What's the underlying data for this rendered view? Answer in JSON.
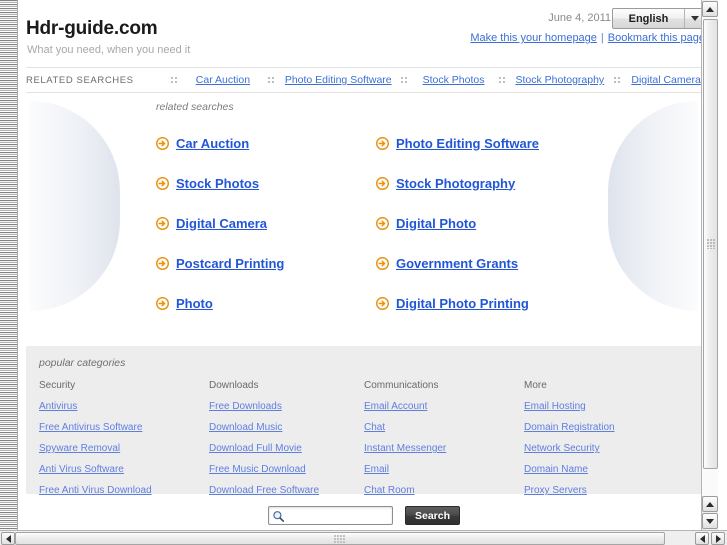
{
  "header": {
    "site_title": "Hdr-guide.com",
    "tagline": "What you need, when you need it",
    "date": "June 4, 2011",
    "language": "English",
    "caret_icon": "chevron-down-icon",
    "homepage_link": "Make this your homepage",
    "link_divider": "|",
    "bookmark_link": "Bookmark this page"
  },
  "nav": {
    "label": "RELATED SEARCHES",
    "items": [
      "Car Auction",
      "Photo Editing Software",
      "Stock Photos",
      "Stock Photography",
      "Digital Camera"
    ],
    "separator_icon": "dot-grid-separator-icon"
  },
  "related": {
    "caption": "related searches",
    "arrow_icon": "circle-arrow-right-icon",
    "items": [
      "Car Auction",
      "Photo Editing Software",
      "Stock Photos",
      "Stock Photography",
      "Digital Camera",
      "Digital Photo",
      "Postcard Printing",
      "Government Grants",
      "Photo",
      "Digital Photo Printing"
    ]
  },
  "categories": {
    "caption": "popular categories",
    "columns": [
      {
        "heading": "Security",
        "links": [
          "Antivirus",
          "Free Antivirus Software",
          "Spyware Removal",
          "Anti Virus Software",
          "Free Anti Virus Download"
        ]
      },
      {
        "heading": "Downloads",
        "links": [
          "Free Downloads",
          "Download Music",
          "Download Full Movie",
          "Free Music Download",
          "Download Free Software"
        ]
      },
      {
        "heading": "Communications",
        "links": [
          "Email Account",
          "Chat",
          "Instant Messenger",
          "Email",
          "Chat Room"
        ]
      },
      {
        "heading": "More",
        "links": [
          "Email Hosting",
          "Domain Registration",
          "Network Security",
          "Domain Name",
          "Proxy Servers"
        ]
      }
    ]
  },
  "search": {
    "value": "",
    "placeholder": "",
    "magnifier_icon": "search-icon",
    "button_label": "Search"
  },
  "scrollbars": {
    "up_icon": "triangle-up-icon",
    "down_icon": "triangle-down-icon",
    "left_icon": "triangle-left-icon",
    "right_icon": "triangle-right-icon"
  },
  "colors": {
    "link_blue": "#2255d8",
    "nav_link_blue": "#3b6fd6",
    "category_link_blue": "#5f7fe0",
    "arrow_orange": "#f29400",
    "panel_gray": "#ededed"
  }
}
